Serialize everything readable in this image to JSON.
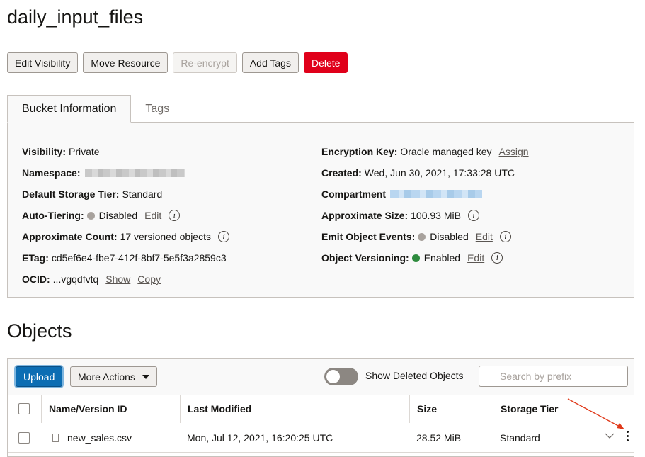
{
  "page": {
    "title": "daily_input_files"
  },
  "actions": {
    "edit_visibility": "Edit Visibility",
    "move_resource": "Move Resource",
    "re_encrypt": "Re-encrypt",
    "add_tags": "Add Tags",
    "delete": "Delete"
  },
  "tabs": {
    "bucket_information": "Bucket Information",
    "tags": "Tags"
  },
  "details": {
    "visibility": {
      "label": "Visibility:",
      "value": "Private"
    },
    "namespace": {
      "label": "Namespace:"
    },
    "default_storage_tier": {
      "label": "Default Storage Tier:",
      "value": "Standard"
    },
    "auto_tiering": {
      "label": "Auto-Tiering:",
      "value": "Disabled",
      "link": "Edit"
    },
    "approximate_count": {
      "label": "Approximate Count:",
      "value": "17 versioned objects"
    },
    "etag": {
      "label": "ETag:",
      "value": "cd5ef6e4-fbe7-412f-8bf7-5e5f3a2859c3"
    },
    "ocid": {
      "label": "OCID:",
      "value": "...vgqdfvtq",
      "show_link": "Show",
      "copy_link": "Copy"
    },
    "encryption_key": {
      "label": "Encryption Key:",
      "value": "Oracle managed key",
      "link": "Assign"
    },
    "created": {
      "label": "Created:",
      "value": "Wed, Jun 30, 2021, 17:33:28 UTC"
    },
    "compartment": {
      "label": "Compartment"
    },
    "approximate_size": {
      "label": "Approximate Size:",
      "value": "100.93 MiB"
    },
    "emit_object_events": {
      "label": "Emit Object Events:",
      "value": "Disabled",
      "link": "Edit"
    },
    "object_versioning": {
      "label": "Object Versioning:",
      "value": "Enabled",
      "link": "Edit"
    }
  },
  "objects": {
    "title": "Objects",
    "toolbar": {
      "upload": "Upload",
      "more_actions": "More Actions",
      "show_deleted_label": "Show Deleted Objects",
      "show_deleted_on": false,
      "search_placeholder": "Search by prefix"
    },
    "columns": [
      "Name/Version ID",
      "Last Modified",
      "Size",
      "Storage Tier"
    ],
    "rows": [
      {
        "name": "new_sales.csv",
        "last_modified": "Mon, Jul 12, 2021, 16:20:25 UTC",
        "size": "28.52 MiB",
        "storage_tier": "Standard"
      }
    ]
  },
  "icons": {
    "info": "info-icon",
    "status_disabled": "gray-dot-icon",
    "status_enabled": "green-dot-icon",
    "search": "search-icon",
    "file": "file-icon",
    "kebab": "kebab-menu-icon",
    "chevron": "chevron-down-icon",
    "caret": "caret-down-icon"
  },
  "colors": {
    "danger": "#e0001a",
    "primary": "#0c6db3",
    "enabled": "#2e8b3e",
    "disabled": "#a8a29d",
    "annotation_arrow": "#e0391a"
  }
}
